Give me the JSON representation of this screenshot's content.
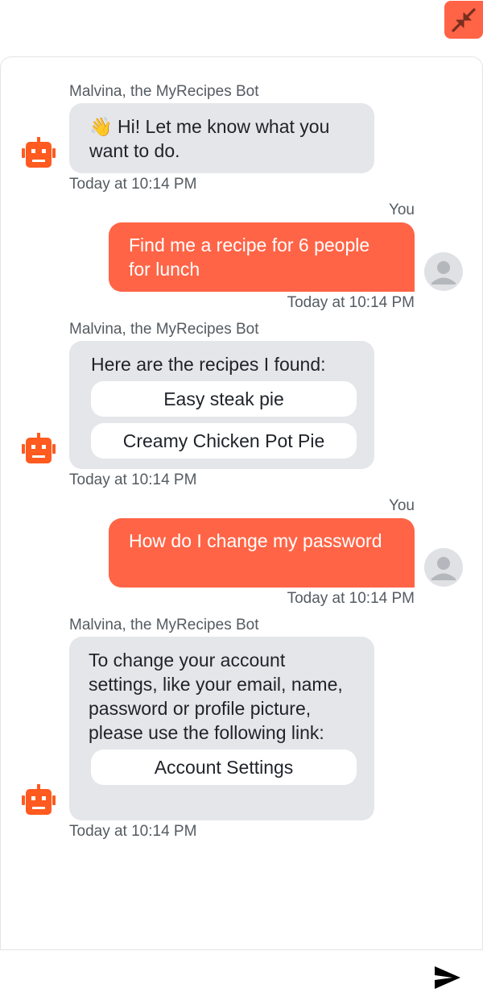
{
  "header": {
    "minimize_icon": "collapse-arrows-icon",
    "accent_color": "#ff6446"
  },
  "messages": [
    {
      "role": "bot",
      "sender": "Malvina, the MyRecipes Bot",
      "emoji": "👋",
      "text": "Hi! Let me know what you want to do.",
      "time": "Today at 10:14 PM"
    },
    {
      "role": "user",
      "sender": "You",
      "text": "Find me a recipe for 6 people for lunch",
      "time": "Today at 10:14 PM"
    },
    {
      "role": "bot",
      "sender": "Malvina, the MyRecipes Bot",
      "text": "Here are the recipes I found:",
      "options": [
        "Easy steak pie",
        "Creamy Chicken Pot Pie"
      ],
      "time": "Today at 10:14 PM"
    },
    {
      "role": "user",
      "sender": "You",
      "text": "How do I change my password",
      "time": "Today at 10:14 PM"
    },
    {
      "role": "bot",
      "sender": "Malvina, the MyRecipes Bot",
      "text": "To change your account settings, like your email, name, password or profile picture, please use the following link:",
      "options": [
        "Account Settings"
      ],
      "time": "Today at 10:14 PM"
    }
  ],
  "composer": {
    "placeholder": "",
    "send_icon": "send-icon"
  },
  "colors": {
    "user_bubble": "#ff6446",
    "bot_bubble": "#e4e6ea",
    "bot_avatar": "#ff5a1f"
  }
}
